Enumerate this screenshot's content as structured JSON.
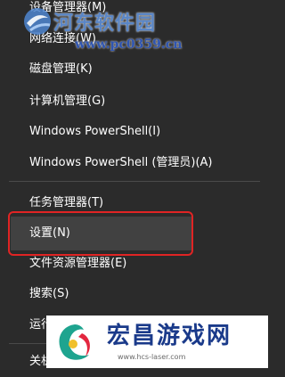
{
  "menu": {
    "items": [
      {
        "label": "设备管理器(M)"
      },
      {
        "label": "网络连接(W)"
      },
      {
        "label": "磁盘管理(K)"
      },
      {
        "label": "计算机管理(G)"
      },
      {
        "label": "Windows PowerShell(I)"
      },
      {
        "label": "Windows PowerShell (管理员)(A)"
      },
      {
        "label": "任务管理器(T)"
      },
      {
        "label": "设置(N)",
        "selected": true
      },
      {
        "label": "文件资源管理器(E)"
      },
      {
        "label": "搜索(S)"
      },
      {
        "label": "运行(R)"
      },
      {
        "label": "关机"
      }
    ]
  },
  "watermark_top": {
    "title": "河东软件园",
    "url": "www.pc0359.cn"
  },
  "watermark_bottom": {
    "name": "宏昌游戏网",
    "site": "www.hcs-laser.com"
  },
  "colors": {
    "menu_bg": "#2b2b2b",
    "selected_bg": "#414141",
    "highlight_border": "#e02424",
    "text": "#ffffff"
  }
}
